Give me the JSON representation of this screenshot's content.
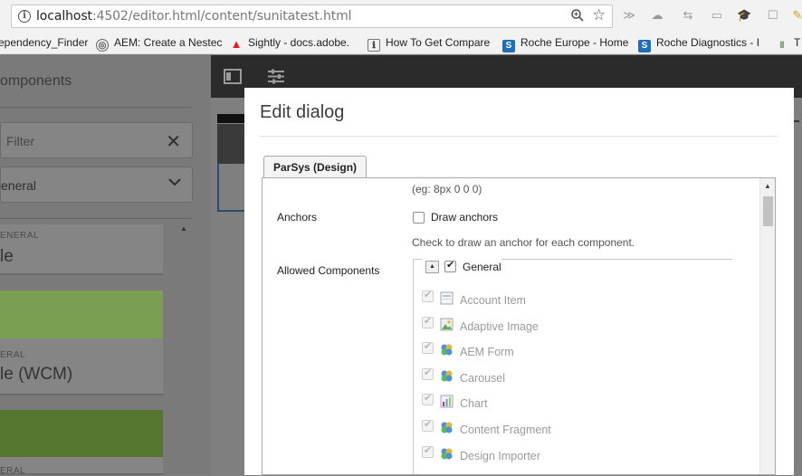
{
  "browser": {
    "url_host": "localhost",
    "url_path": ":4502/editor.html/content/sunitatest.html",
    "bookmarks": [
      {
        "label": "ependency_Finder",
        "icon": "page-icon"
      },
      {
        "label": "AEM: Create a Nestec",
        "icon": "aem-icon"
      },
      {
        "label": "Sightly - docs.adobe.",
        "icon": "adobe-icon"
      },
      {
        "label": "How To Get Compare",
        "icon": "doc-icon"
      },
      {
        "label": "Roche Europe - Home",
        "icon": "sharepoint-icon"
      },
      {
        "label": "Roche Diagnostics - I",
        "icon": "sharepoint-icon"
      },
      {
        "label": "T",
        "icon": "bars-icon"
      }
    ]
  },
  "sidebar": {
    "title": "omponents",
    "filter_placeholder": "Filter",
    "group_select": "eneral",
    "cards": [
      {
        "group": "ENERAL",
        "title": "le",
        "thumb_color": ""
      },
      {
        "group": "ERAL",
        "title": "le (WCM)",
        "thumb_color": "#7a9e52"
      },
      {
        "group": "ERAL",
        "title": "",
        "thumb_color": "#54762f"
      }
    ]
  },
  "dialog": {
    "title": "Edit dialog",
    "tab": "ParSys (Design)",
    "margin_hint": "(eg: 8px 0 0 0)",
    "anchors": {
      "label": "Anchors",
      "checkbox_label": "Draw anchors",
      "checked": false,
      "hint": "Check to draw an anchor for each component."
    },
    "allowed": {
      "label": "Allowed Components",
      "group_label": "General",
      "group_checked": true,
      "items": [
        {
          "label": "Account Item",
          "icon": "page-icon",
          "checked": true
        },
        {
          "label": "Adaptive Image",
          "icon": "image-icon",
          "checked": true
        },
        {
          "label": "AEM Form",
          "icon": "puzzle-icon",
          "checked": true
        },
        {
          "label": "Carousel",
          "icon": "puzzle-icon",
          "checked": true
        },
        {
          "label": "Chart",
          "icon": "chart-icon",
          "checked": true
        },
        {
          "label": "Content Fragment",
          "icon": "puzzle-icon",
          "checked": true
        },
        {
          "label": "Design Importer",
          "icon": "puzzle-icon",
          "checked": true
        }
      ]
    }
  }
}
